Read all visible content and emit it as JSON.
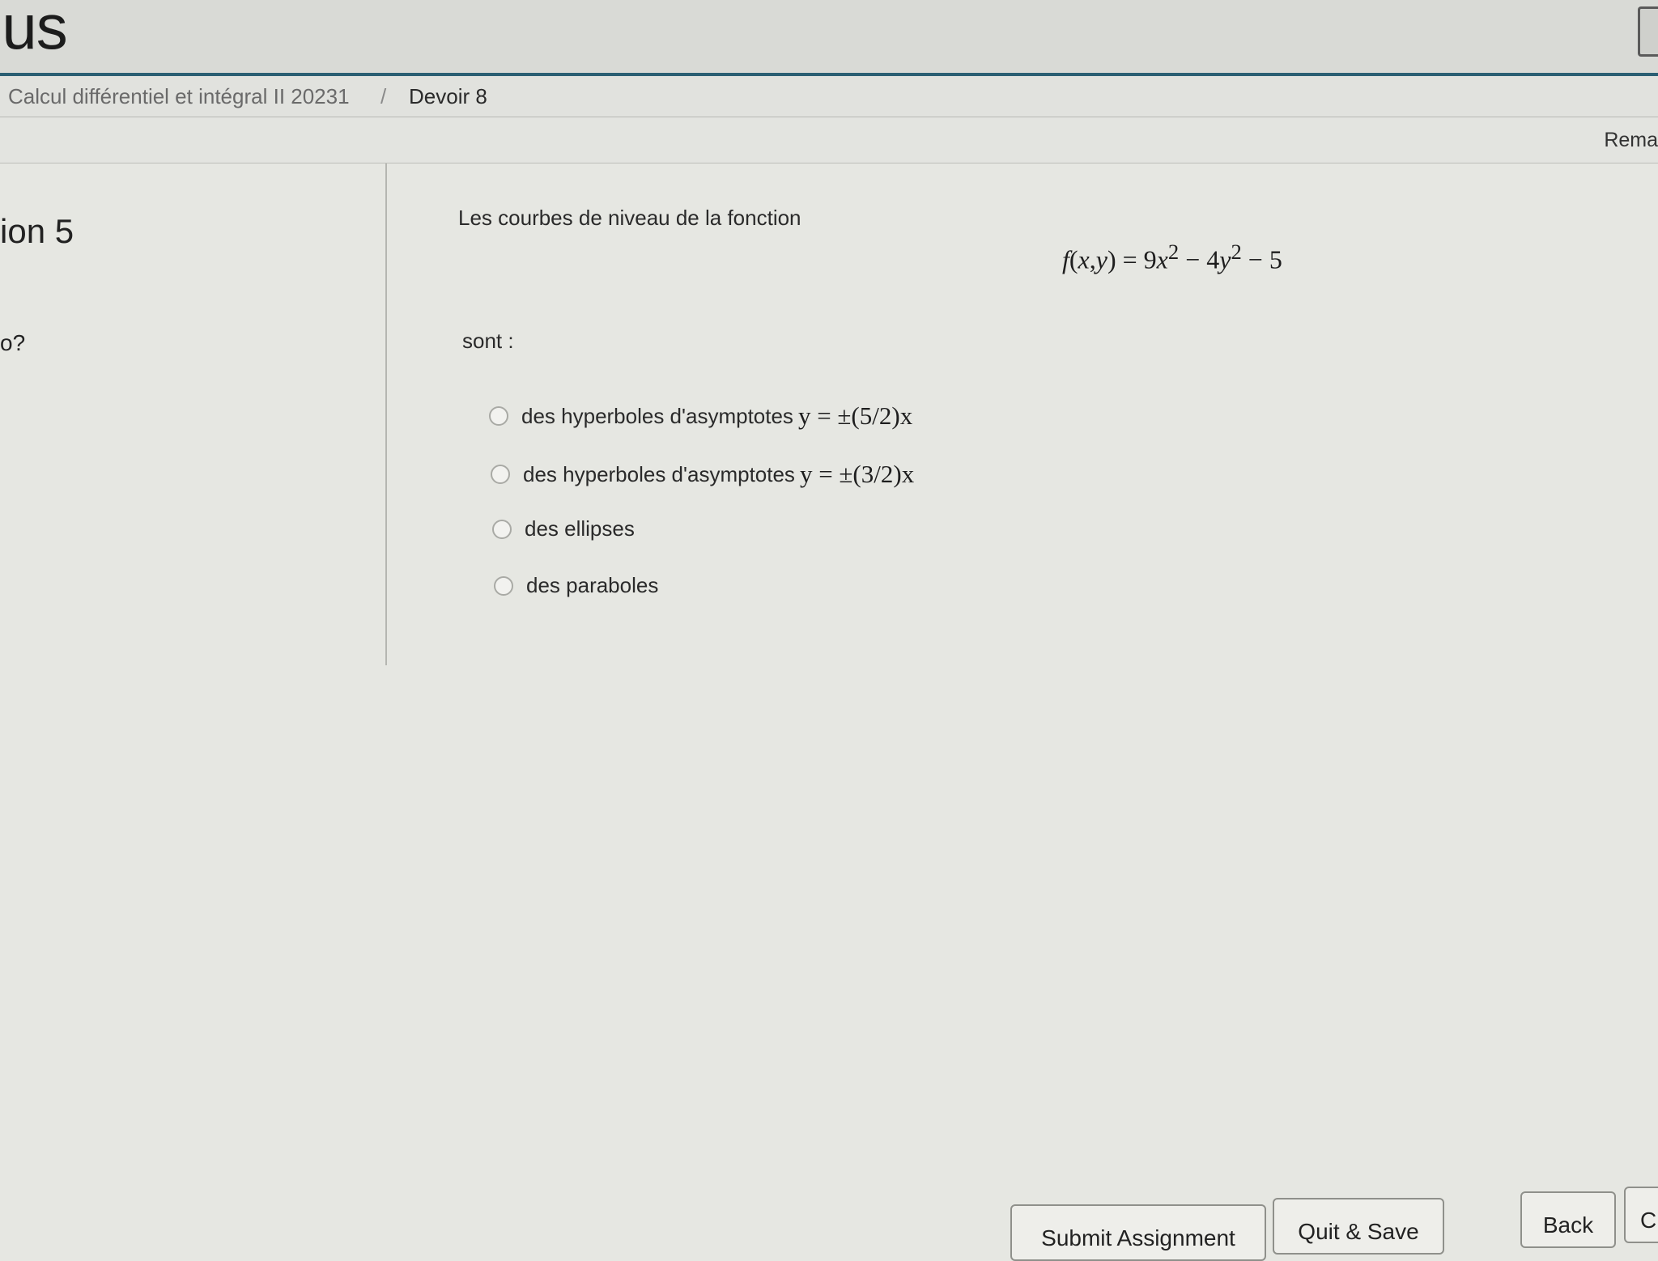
{
  "header": {
    "logo_text": "ius"
  },
  "breadcrumb": {
    "course": "Calcul différentiel et intégral II 20231",
    "separator": "/",
    "assignment": "Devoir 8"
  },
  "status": {
    "remaining_label": "Rema"
  },
  "sidebar": {
    "question_label": "ion 5",
    "extra_label": "o?"
  },
  "question": {
    "prompt": "Les courbes de niveau de la fonction",
    "formula": "f(x,y) = 9x² − 4y² − 5",
    "suffix": "sont :",
    "choices": [
      {
        "text": "des hyperboles d'asymptotes",
        "math": "y = ±(5/2)x"
      },
      {
        "text": "des hyperboles d'asymptotes",
        "math": "y = ±(3/2)x"
      },
      {
        "text": "des ellipses",
        "math": ""
      },
      {
        "text": "des paraboles",
        "math": ""
      }
    ]
  },
  "footer": {
    "submit_label": "Submit Assignment",
    "quit_label": "Quit & Save",
    "back_label": "Back",
    "next_label": "C"
  }
}
